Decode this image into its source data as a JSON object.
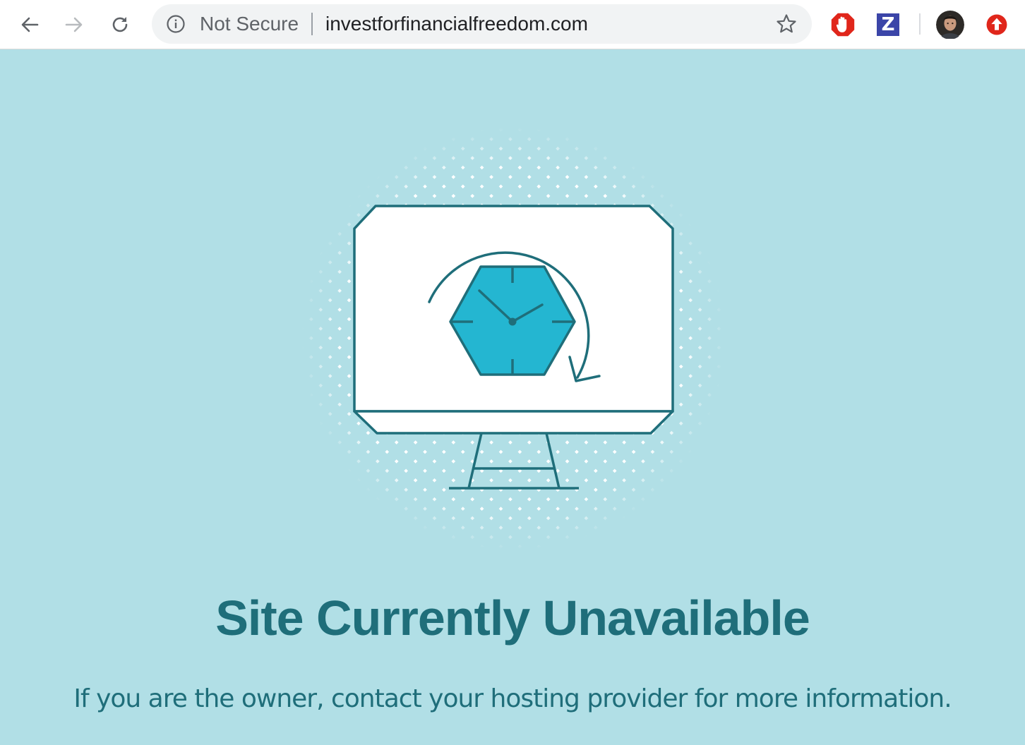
{
  "browser": {
    "back_icon": "arrow-left-icon",
    "forward_icon": "arrow-right-icon",
    "reload_icon": "reload-icon",
    "security_icon": "info-icon",
    "security_label": "Not Secure",
    "url": "investforfinancialfreedom.com",
    "bookmark_icon": "star-icon",
    "extensions": [
      {
        "name": "adblock-icon",
        "color": "#e0261b"
      },
      {
        "name": "z-extension-icon",
        "label": "Z",
        "color": "#3b45a8"
      },
      {
        "name": "profile-avatar"
      },
      {
        "name": "upload-icon",
        "color": "#e0261b"
      }
    ]
  },
  "page": {
    "background": "#b1dfe6",
    "accent": "#1f6e7a",
    "clock_fill": "#24b6d1",
    "illustration_icon": "monitor-clock-icon",
    "headline": "Site Currently Unavailable",
    "message": "If you are the owner, contact your hosting provider for more information."
  }
}
